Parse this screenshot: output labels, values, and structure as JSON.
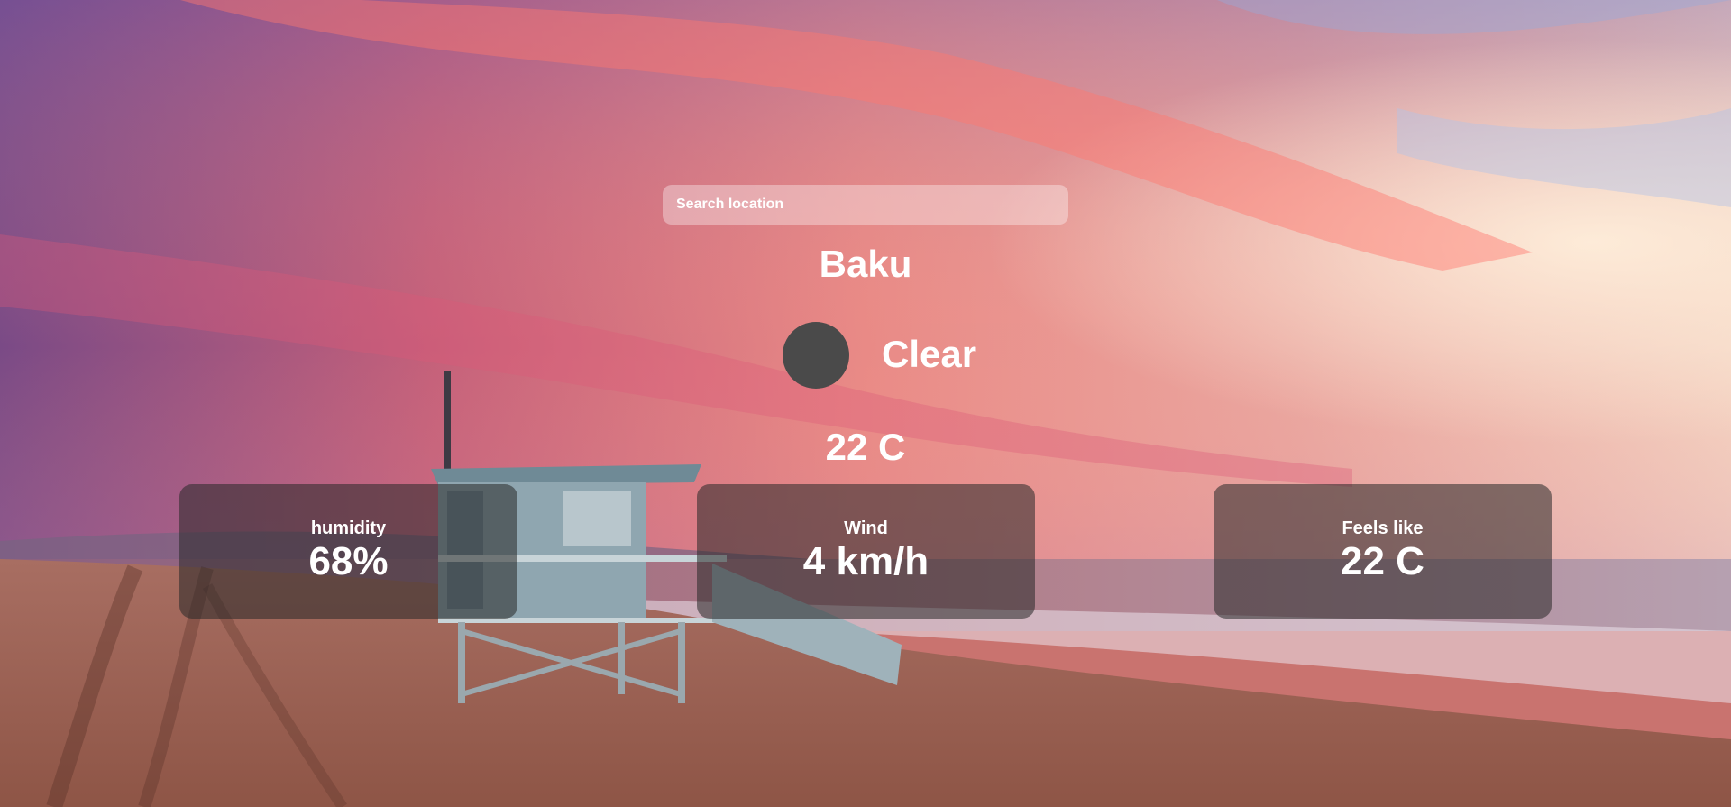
{
  "search": {
    "placeholder": "Search location"
  },
  "location": {
    "city": "Baku"
  },
  "weather": {
    "condition": "Clear",
    "icon": "weather-icon-placeholder",
    "temperature": "22 C"
  },
  "details": {
    "humidity": {
      "label": "humidity",
      "value": "68%"
    },
    "wind": {
      "label": "Wind",
      "value": "4 km/h"
    },
    "feels_like": {
      "label": "Feels like",
      "value": "22 C"
    }
  },
  "colors": {
    "card_background": "rgba(40,40,40,0.55)",
    "icon_fill": "#4a4a4a",
    "text": "#ffffff"
  }
}
